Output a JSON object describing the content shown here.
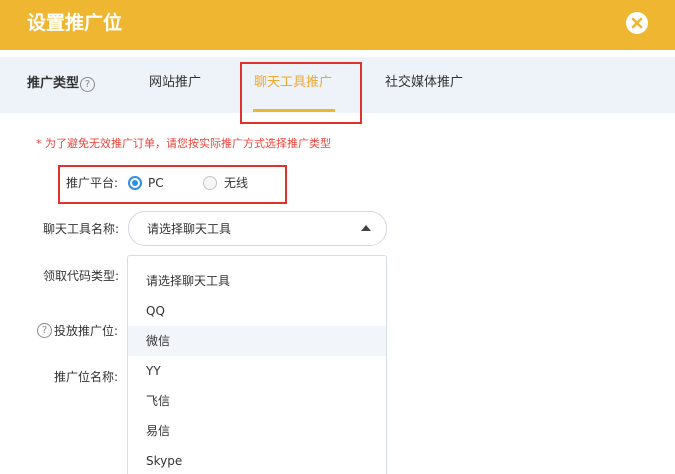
{
  "header": {
    "title": "设置推广位"
  },
  "tabs": {
    "type_label": "推广类型",
    "help_glyph": "?",
    "items": [
      {
        "label": "网站推广"
      },
      {
        "label": "聊天工具推广"
      },
      {
        "label": "社交媒体推广"
      }
    ],
    "active_index": 1
  },
  "notice": "*  为了避免无效推广订单，请您按实际推广方式选择推广类型",
  "form": {
    "platform_label": "推广平台:",
    "platform_options": [
      {
        "label": "PC",
        "checked": true
      },
      {
        "label": "无线",
        "checked": false
      }
    ],
    "tool_label": "聊天工具名称:",
    "tool_select_value": "请选择聊天工具",
    "code_type_label": "领取代码类型:",
    "placement_label": "投放推广位:",
    "placement_help_glyph": "?",
    "position_name_label": "推广位名称:"
  },
  "dropdown": {
    "options": [
      "请选择聊天工具",
      "QQ",
      "微信",
      "YY",
      "飞信",
      "易信",
      "Skype"
    ],
    "highlighted_index": 2
  },
  "colors": {
    "header_bg": "#efb731",
    "active_tab": "#efa92f",
    "notice_red": "#e8453c",
    "annotation_red": "#e0322d",
    "radio_blue": "#2f8ee8",
    "tabbar_bg": "#eef2f9"
  }
}
